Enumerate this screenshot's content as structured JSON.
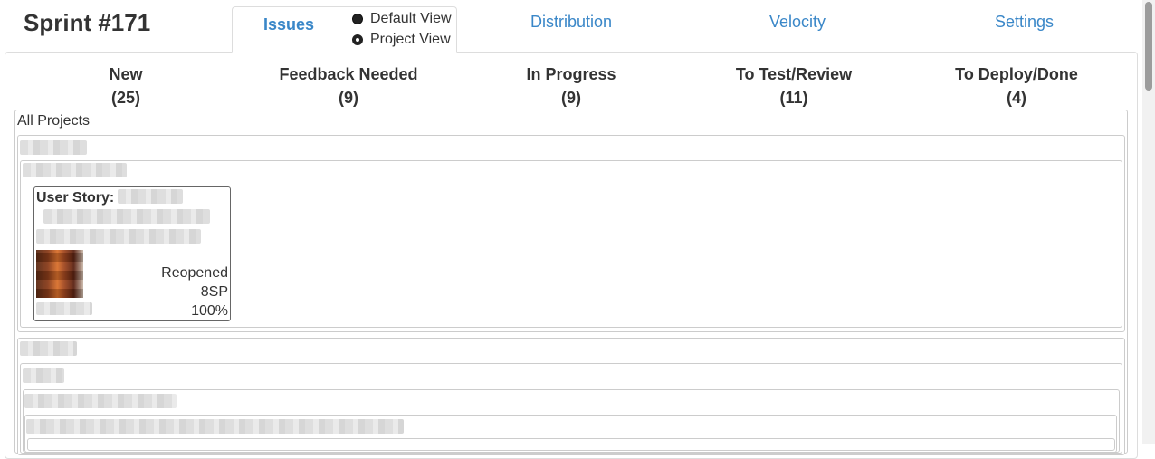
{
  "sprint": {
    "title": "Sprint #171"
  },
  "tabs": {
    "issues": "Issues",
    "distribution": "Distribution",
    "velocity": "Velocity",
    "settings": "Settings"
  },
  "view_options": {
    "default_view": "Default View",
    "project_view": "Project View",
    "selected": "Project View"
  },
  "columns": [
    {
      "name": "New",
      "count": "(25)"
    },
    {
      "name": "Feedback Needed",
      "count": "(9)"
    },
    {
      "name": "In Progress",
      "count": "(9)"
    },
    {
      "name": "To Test/Review",
      "count": "(11)"
    },
    {
      "name": "To Deploy/Done",
      "count": "(4)"
    }
  ],
  "board": {
    "all_projects_label": "All Projects",
    "card": {
      "type": "User Story:",
      "status": "Reopened",
      "story_points": "8SP",
      "progress": "100%"
    }
  },
  "colors": {
    "link": "#3a87c8",
    "text": "#333333",
    "border": "#dddddd"
  }
}
